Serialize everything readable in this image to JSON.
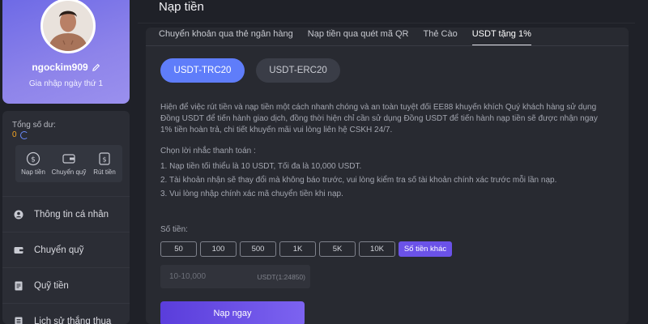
{
  "profile": {
    "username": "ngockim909",
    "joined": "Gia nhập ngày thứ 1"
  },
  "wallet": {
    "balance_label": "Tổng số dư:",
    "balance_value": "0",
    "actions": [
      {
        "label": "Nạp tiền",
        "icon": "deposit-icon"
      },
      {
        "label": "Chuyển quỹ",
        "icon": "wallet-icon"
      },
      {
        "label": "Rút tiền",
        "icon": "withdraw-icon"
      }
    ]
  },
  "menu": {
    "items": [
      {
        "label": "Thông tin cá nhân",
        "icon": "user-icon"
      },
      {
        "label": "Chuyển quỹ",
        "icon": "wallet-icon"
      },
      {
        "label": "Quỹ tiền",
        "icon": "document-icon"
      },
      {
        "label": "Lịch sử thắng thua",
        "icon": "history-icon"
      }
    ]
  },
  "page": {
    "title": "Nạp tiền",
    "tabs": [
      {
        "label": "Chuyển khoản qua thẻ ngân hàng"
      },
      {
        "label": "Nạp tiền qua quét mã QR"
      },
      {
        "label": "Thẻ Cào"
      },
      {
        "label": "USDT tặng 1%"
      }
    ],
    "active_tab": "USDT tặng 1%",
    "networks": [
      {
        "label": "USDT-TRC20"
      },
      {
        "label": "USDT-ERC20"
      }
    ],
    "active_network": "USDT-TRC20",
    "info": "Hiện để việc rút tiền và nạp tiền một cách nhanh chóng và an toàn tuyệt đối EE88 khuyến khích Quý khách hàng sử dụng Đồng USDT để tiến hành giao dịch, đồng thời hiện chỉ cần sử dụng Đồng USDT để tiến hành nạp tiền sẽ được nhận ngay 1% tiền hoàn trả, chi tiết khuyến mãi vui lòng liên hệ CSKH 24/7.",
    "choose_label": "Chọn lời nhắc thanh toán :",
    "rules": [
      "1. Nạp tiền tối thiểu là 10 USDT, Tối đa là 10,000 USDT.",
      "2. Tài khoản nhận sẽ thay đổi mà không báo trước, vui lòng kiểm tra số tài khoản chính xác trước mỗi lần nạp.",
      "3. Vui lòng nhập chính xác mã chuyển tiền khi nạp."
    ],
    "amount_label": "Số tiền:",
    "amount_options": [
      "50",
      "100",
      "500",
      "1K",
      "5K",
      "10K",
      "Số tiền khác"
    ],
    "active_amount": "Số tiền khác",
    "amount_placeholder": "10-10,000",
    "amount_unit": "USDT(1:24850)",
    "submit_label": "Nạp ngay"
  },
  "colors": {
    "accent": "#5f7dfa",
    "purple": "#6b52e8",
    "balance": "#f5a623",
    "background": "#1f2128"
  }
}
